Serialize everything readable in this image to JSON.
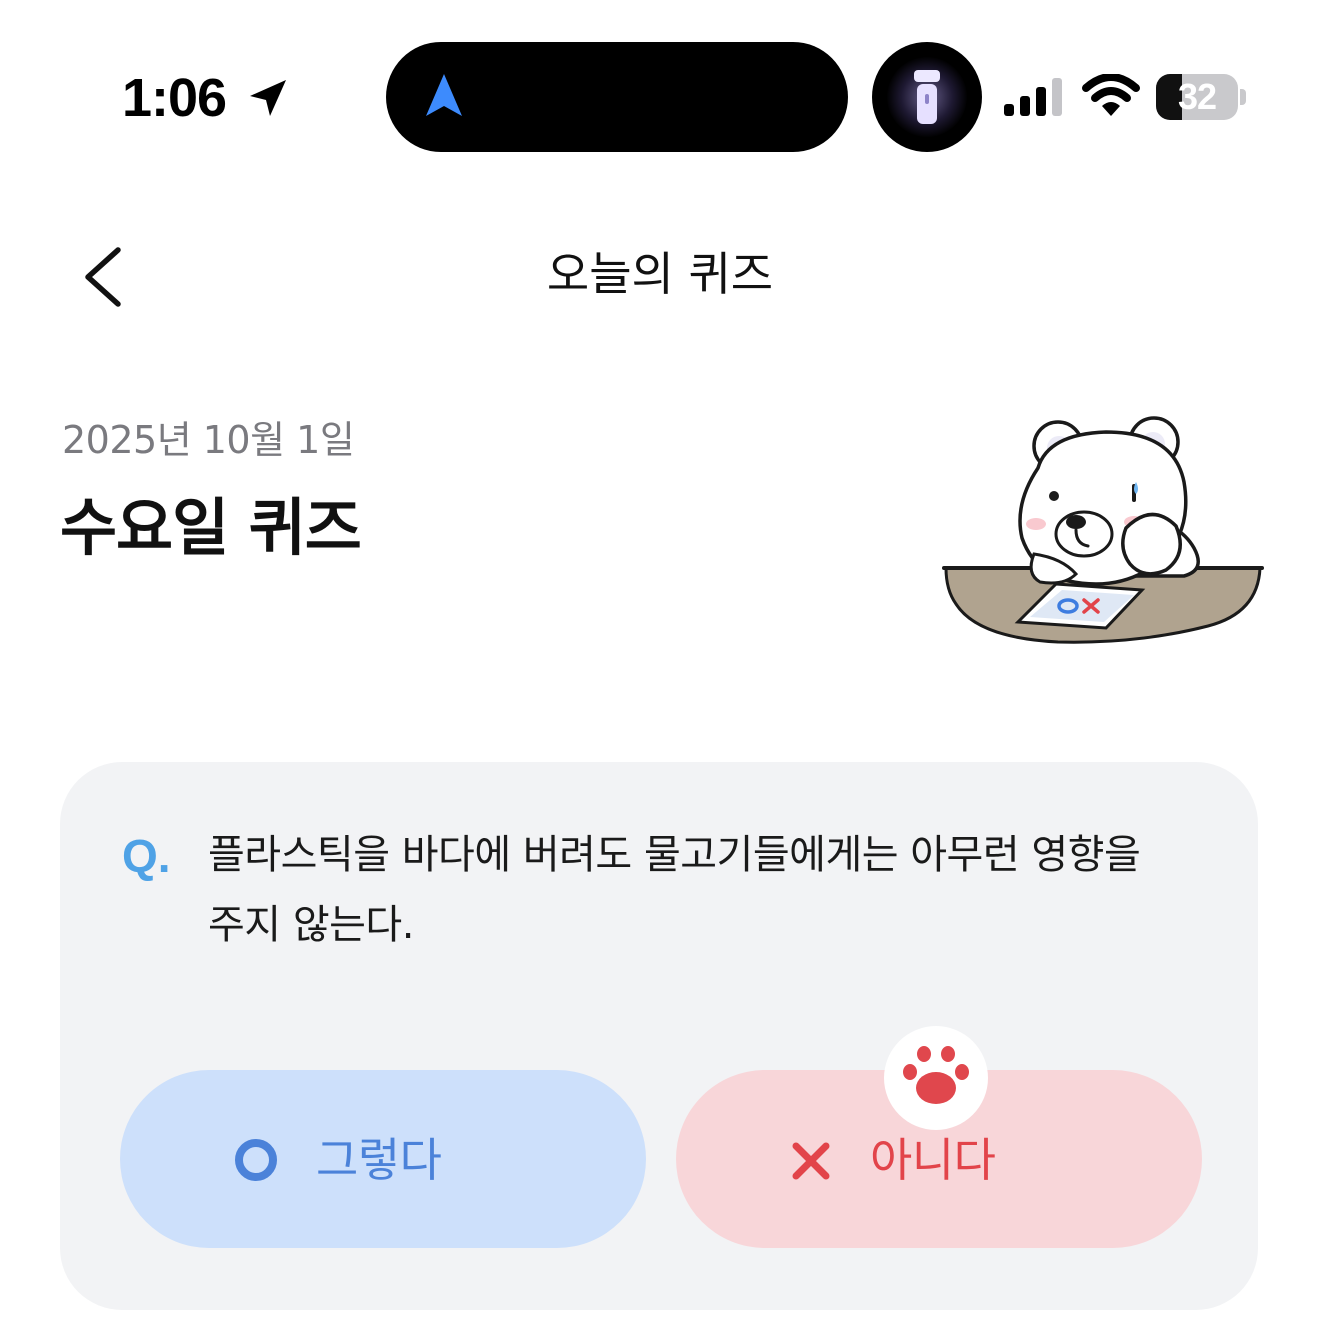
{
  "status_bar": {
    "time": "1:06",
    "battery_level": "32",
    "location_icon": "location-arrow-icon",
    "nav_icon": "navigation-arrow-icon",
    "torch_icon": "flashlight-icon",
    "signal_icon": "cellular-signal-icon",
    "wifi_icon": "wifi-icon",
    "battery_icon": "battery-icon"
  },
  "nav": {
    "title": "오늘의 퀴즈",
    "back_icon": "chevron-left-icon"
  },
  "header": {
    "date": "2025년 10월 1일",
    "title": "수요일 퀴즈",
    "illustration": "polar-bear-ox-quiz-illustration"
  },
  "quiz": {
    "q_label": "Q.",
    "question": "플라스틱을 바다에 버려도 물고기들에게는 아무런 영향을 주지 않는다.",
    "answers": [
      {
        "label": "그렇다",
        "icon": "circle-o-icon"
      },
      {
        "label": "아니다",
        "icon": "x-cross-icon"
      }
    ],
    "badge_icon": "paw-icon"
  },
  "colors": {
    "background": "#ffffff",
    "card_background": "#f2f3f5",
    "q_mark": "#4fa2e6",
    "yes_background": "#cde0fb",
    "yes_text": "#4b82d9",
    "no_background": "#f8d6d9",
    "no_text": "#e2444a",
    "paw": "#e0474d",
    "date_text": "#7a7a7f"
  }
}
